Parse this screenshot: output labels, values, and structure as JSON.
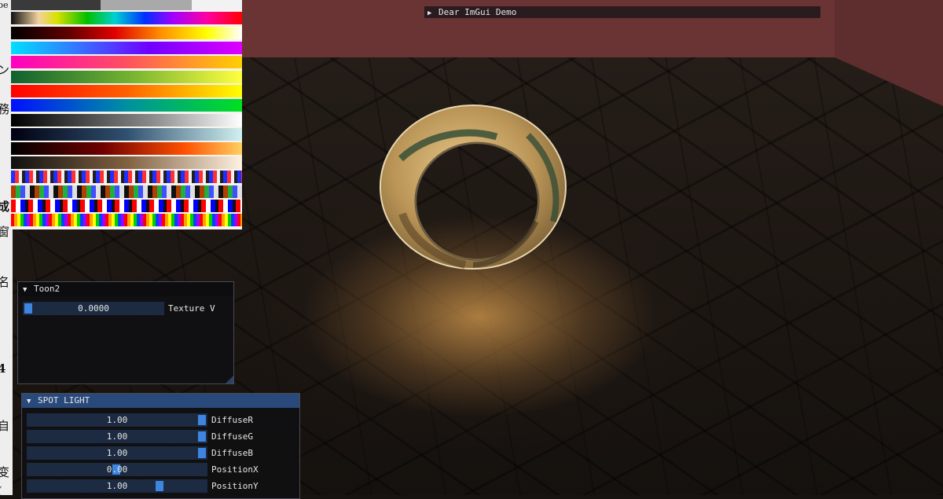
{
  "demo_window": {
    "title": "Dear ImGui Demo",
    "collapsed_arrow": "▶"
  },
  "toon_window": {
    "title": "Toon2",
    "expanded_arrow": "▼",
    "sliders": [
      {
        "value": "0.0000",
        "label": "Texture V",
        "fraction": 0.0
      }
    ]
  },
  "spot_light_window": {
    "title": "SPOT LIGHT",
    "expanded_arrow": "▼",
    "sliders": [
      {
        "value": "1.00",
        "label": "DiffuseR",
        "fraction": 1.0
      },
      {
        "value": "1.00",
        "label": "DiffuseG",
        "fraction": 1.0
      },
      {
        "value": "1.00",
        "label": "DiffuseB",
        "fraction": 1.0
      },
      {
        "value": "0.00",
        "label": "PositionX",
        "fraction": 0.5
      },
      {
        "value": "1.00",
        "label": "PositionY",
        "fraction": 0.75
      }
    ]
  },
  "left_page_fragments": [
    "be",
    "ン",
    "務",
    "成",
    "窗",
    "名",
    "4",
    "自",
    "变",
    "("
  ],
  "colors": {
    "back_wall": "#6b3434",
    "imgui_title_active": "#29497a",
    "imgui_slider_bg": "#1d2b42",
    "imgui_slider_grab": "#3d85e0"
  }
}
